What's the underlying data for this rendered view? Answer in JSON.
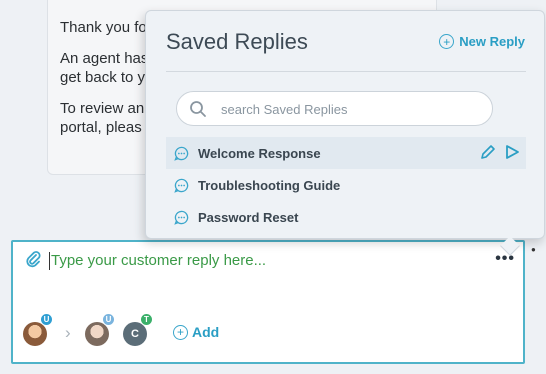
{
  "agent_message": {
    "line1": "Thank you fo",
    "line2": "An agent has",
    "line3": "get back to y",
    "line4": "To review an",
    "line5": "portal, pleas"
  },
  "composer": {
    "placeholder": "Type your customer reply here...",
    "add_label": "Add",
    "participants": [
      {
        "badge": "U"
      },
      {
        "badge": "U"
      },
      {
        "initial": "C",
        "badge": "T"
      }
    ]
  },
  "saved_replies": {
    "title": "Saved Replies",
    "new_reply_label": "New Reply",
    "search_placeholder": "search Saved Replies",
    "items": [
      {
        "label": "Welcome Response",
        "active": true
      },
      {
        "label": "Troubleshooting Guide",
        "active": false
      },
      {
        "label": "Password Reset",
        "active": false
      }
    ]
  },
  "colors": {
    "accent": "#2a9ec4",
    "composer_border": "#4fb3c9",
    "placeholder_text": "#3a9a47",
    "badge_user": "#2f9fd3",
    "badge_team": "#3bb06a"
  },
  "icons": [
    "paperclip-icon",
    "more-icon",
    "search-icon",
    "chat-bubble-icon",
    "pencil-icon",
    "send-icon",
    "plus-circle-icon",
    "chevron-right-icon"
  ]
}
